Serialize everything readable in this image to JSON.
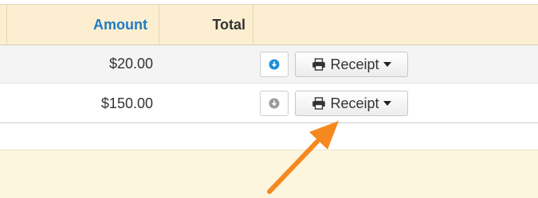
{
  "table": {
    "columns": {
      "amount": "Amount",
      "total": "Total"
    },
    "rows": [
      {
        "amount": "$20.00",
        "download_state": "active",
        "receipt_label": "Receipt"
      },
      {
        "amount": "$150.00",
        "download_state": "inactive",
        "receipt_label": "Receipt"
      }
    ]
  },
  "icons": {
    "download_active": "download-circle-icon",
    "download_inactive": "download-circle-icon",
    "printer": "printer-icon",
    "caret": "caret-down-icon",
    "annotation": "orange-arrow"
  },
  "colors": {
    "header_bg": "#fcefd1",
    "accent_blue": "#1f7bc4",
    "arrow_orange": "#f5891f"
  }
}
